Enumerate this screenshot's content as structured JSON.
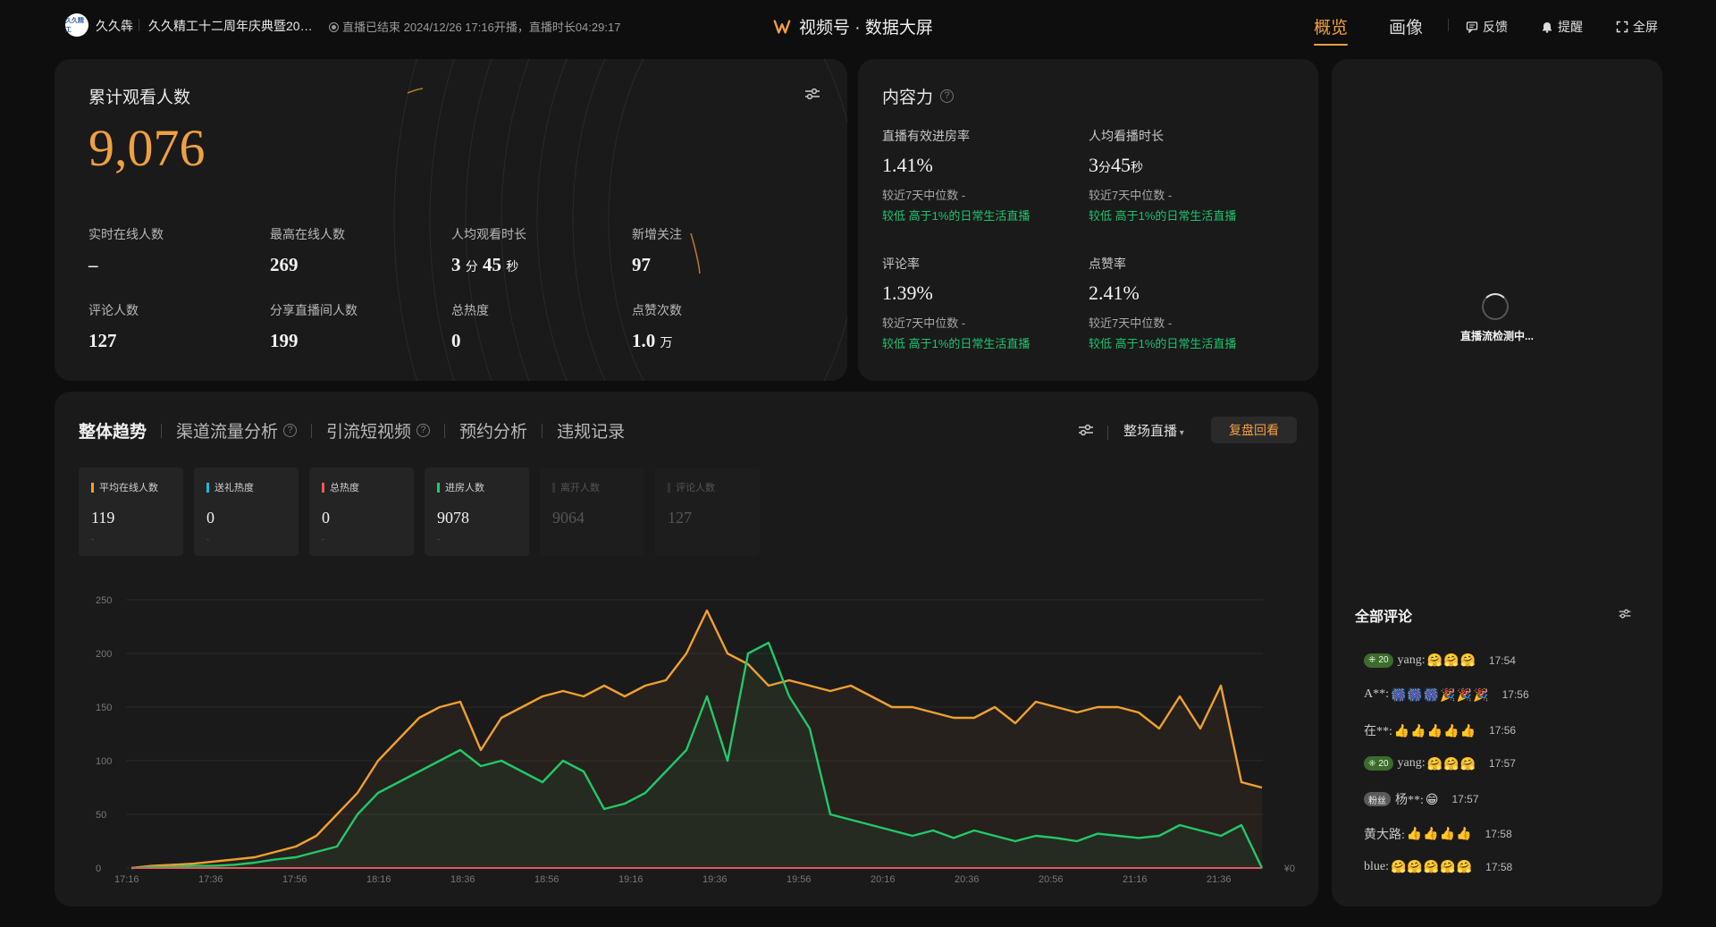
{
  "header": {
    "brand_logo": "久久精工",
    "brand_name": "久久犇",
    "live_title": "久久精工十二周年庆典暨20…",
    "live_status": "直播已结束 2024/12/26 17:16开播，直播时长04:29:17",
    "center_title": "视频号 · 数据大屏",
    "nav": [
      "概览",
      "画像"
    ],
    "tools": {
      "feedback": "反馈",
      "remind": "提醒",
      "fullscreen": "全屏"
    }
  },
  "audience": {
    "title": "累计观看人数",
    "total": "9,076",
    "stats": [
      {
        "label": "实时在线人数",
        "value": "–",
        "unit1": "",
        "value2": "",
        "unit2": ""
      },
      {
        "label": "最高在线人数",
        "value": "269",
        "unit1": "",
        "value2": "",
        "unit2": ""
      },
      {
        "label": "人均观看时长",
        "value": "3",
        "unit1": "分",
        "value2": "45",
        "unit2": "秒"
      },
      {
        "label": "新增关注",
        "value": "97",
        "unit1": "",
        "value2": "",
        "unit2": ""
      },
      {
        "label": "评论人数",
        "value": "127",
        "unit1": "",
        "value2": "",
        "unit2": ""
      },
      {
        "label": "分享直播间人数",
        "value": "199",
        "unit1": "",
        "value2": "",
        "unit2": ""
      },
      {
        "label": "总热度",
        "value": "0",
        "unit1": "",
        "value2": "",
        "unit2": ""
      },
      {
        "label": "点赞次数",
        "value": "1.0",
        "unit1": "万",
        "value2": "",
        "unit2": ""
      }
    ]
  },
  "content_power": {
    "title": "内容力",
    "stats": [
      {
        "label": "直播有效进房率",
        "value": "1.41%",
        "unit": "",
        "value2": "",
        "unit2": "",
        "compare": "较近7天中位数 -",
        "compare2": "较低 高于1%的日常生活直播"
      },
      {
        "label": "人均看播时长",
        "value": "3",
        "unit": "分",
        "value2": "45",
        "unit2": "秒",
        "compare": "较近7天中位数 -",
        "compare2": "较低 高于1%的日常生活直播"
      },
      {
        "label": "评论率",
        "value": "1.39%",
        "unit": "",
        "value2": "",
        "unit2": "",
        "compare": "较近7天中位数 -",
        "compare2": "较低 高于1%的日常生活直播"
      },
      {
        "label": "点赞率",
        "value": "2.41%",
        "unit": "",
        "value2": "",
        "unit2": "",
        "compare": "较近7天中位数 -",
        "compare2": "较低 高于1%的日常生活直播"
      }
    ]
  },
  "preview": {
    "loading_text": "直播流检测中..."
  },
  "comments": {
    "title": "全部评论",
    "items": [
      {
        "badge_type": "lv",
        "badge": "20",
        "user": "yang:",
        "emoji": "🤗🤗🤗",
        "time": "17:54"
      },
      {
        "badge_type": "",
        "badge": "",
        "user": "A**:",
        "emoji": "🎆🎆🎆🎉🎉🎉",
        "time": "17:56"
      },
      {
        "badge_type": "",
        "badge": "",
        "user": "在**:",
        "emoji": "👍👍👍👍👍",
        "time": "17:56"
      },
      {
        "badge_type": "lv",
        "badge": "20",
        "user": "yang:",
        "emoji": "🤗🤗🤗",
        "time": "17:57"
      },
      {
        "badge_type": "fan",
        "badge": "粉丝",
        "user": "杨**:",
        "emoji": "😁",
        "time": "17:57"
      },
      {
        "badge_type": "",
        "badge": "",
        "user": "黄大路:",
        "emoji": "👍👍👍👍",
        "time": "17:58"
      },
      {
        "badge_type": "",
        "badge": "",
        "user": "blue:",
        "emoji": "🤗🤗🤗🤗🤗",
        "time": "17:58"
      }
    ]
  },
  "trend": {
    "tabs": [
      "整体趋势",
      "渠道流量分析",
      "引流短视频",
      "预约分析",
      "违规记录"
    ],
    "scope": "整场直播",
    "review_button": "复盘回看",
    "metrics": [
      {
        "label": "平均在线人数",
        "value": "119",
        "sub": "-",
        "color": "#f0a030",
        "dim": false
      },
      {
        "label": "送礼热度",
        "value": "0",
        "sub": "-",
        "color": "#22b8d8",
        "dim": false
      },
      {
        "label": "总热度",
        "value": "0",
        "sub": "-",
        "color": "#e85a5a",
        "dim": false
      },
      {
        "label": "进房人数",
        "value": "9078",
        "sub": "-",
        "color": "#22c86a",
        "dim": false
      },
      {
        "label": "离开人数",
        "value": "9064",
        "sub": "",
        "color": "#333",
        "dim": true
      },
      {
        "label": "评论人数",
        "value": "127",
        "sub": "",
        "color": "#333",
        "dim": true
      }
    ]
  },
  "chart_data": {
    "type": "line",
    "x": [
      "17:16",
      "17:36",
      "17:56",
      "18:16",
      "18:36",
      "18:56",
      "19:16",
      "19:36",
      "19:56",
      "20:16",
      "20:36",
      "20:56",
      "21:16",
      "21:36"
    ],
    "ylim": [
      0,
      250
    ],
    "yticks": [
      0,
      50,
      100,
      150,
      200,
      250
    ],
    "right_axis_label": "¥0",
    "grid": true,
    "series": [
      {
        "color": "#f0a030",
        "values": [
          0,
          2,
          3,
          4,
          6,
          8,
          10,
          15,
          20,
          30,
          50,
          70,
          100,
          120,
          140,
          150,
          155,
          110,
          140,
          150,
          160,
          165,
          160,
          170,
          160,
          170,
          175,
          200,
          240,
          200,
          190,
          170,
          175,
          170,
          165,
          170,
          160,
          150,
          150,
          145,
          140,
          140,
          150,
          135,
          155,
          150,
          145,
          150,
          150,
          145,
          130,
          160,
          130,
          170,
          80,
          75
        ]
      },
      {
        "color": "#22c86a",
        "values": [
          0,
          1,
          1,
          2,
          2,
          3,
          5,
          8,
          10,
          15,
          20,
          50,
          70,
          80,
          90,
          100,
          110,
          95,
          100,
          90,
          80,
          100,
          90,
          55,
          60,
          70,
          90,
          110,
          160,
          100,
          200,
          210,
          160,
          130,
          50,
          45,
          40,
          35,
          30,
          35,
          28,
          35,
          30,
          25,
          30,
          28,
          25,
          32,
          30,
          28,
          30,
          40,
          35,
          30,
          40,
          0
        ]
      },
      {
        "color": "#e85a5a",
        "values": [
          0,
          0,
          0,
          0,
          0,
          0,
          0,
          0,
          0,
          0,
          0,
          0,
          0,
          0,
          0,
          0,
          0,
          0,
          0,
          0,
          0,
          0,
          0,
          0,
          0,
          0,
          0,
          0,
          0,
          0,
          0,
          0,
          0,
          0,
          0,
          0,
          0,
          0,
          0,
          0,
          0,
          0,
          0,
          0,
          0,
          0,
          0,
          0,
          0,
          0,
          0,
          0,
          0,
          0,
          0,
          0
        ]
      }
    ]
  }
}
